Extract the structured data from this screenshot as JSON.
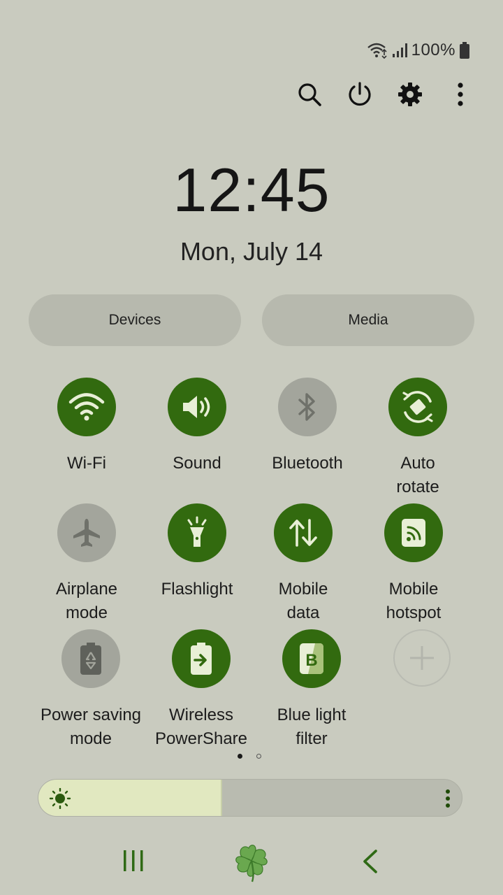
{
  "status": {
    "battery_pct": "100%",
    "icons": [
      "wifi-calling-icon",
      "signal-icon",
      "battery-icon"
    ]
  },
  "top_actions": [
    "search-icon",
    "power-icon",
    "gear-icon",
    "more-vert-icon"
  ],
  "clock": {
    "time": "12:45",
    "date": "Mon, July 14"
  },
  "pills": {
    "devices": "Devices",
    "media": "Media"
  },
  "tiles": [
    {
      "label": "Wi-Fi",
      "state": "on",
      "icon": "wifi-icon"
    },
    {
      "label": "Sound",
      "state": "on",
      "icon": "volume-icon"
    },
    {
      "label": "Bluetooth",
      "state": "off",
      "icon": "bluetooth-icon"
    },
    {
      "label": "Auto\nrotate",
      "state": "on",
      "icon": "auto-rotate-icon"
    },
    {
      "label": "Airplane\nmode",
      "state": "off",
      "icon": "airplane-icon"
    },
    {
      "label": "Flashlight",
      "state": "on",
      "icon": "flashlight-icon"
    },
    {
      "label": "Mobile\ndata",
      "state": "on",
      "icon": "mobile-data-icon"
    },
    {
      "label": "Mobile\nhotspot",
      "state": "on",
      "icon": "hotspot-icon"
    },
    {
      "label": "Power saving\nmode",
      "state": "off",
      "icon": "power-saving-icon"
    },
    {
      "label": "Wireless\nPowerShare",
      "state": "on",
      "icon": "wireless-powershare-icon"
    },
    {
      "label": "Blue light\nfilter",
      "state": "on",
      "icon": "blue-light-filter-icon"
    },
    {
      "label": "",
      "state": "add",
      "icon": "add-icon"
    }
  ],
  "pager": {
    "pages": 2,
    "current": 1
  },
  "brightness": {
    "level": 0.43
  },
  "colors": {
    "accent": "#326a0f",
    "background": "#c9cbbf",
    "tile_off": "#a3a59c",
    "brightness_fill": "#e1e8c0"
  },
  "navbar": [
    "recent-apps-icon",
    "home-clover-icon",
    "back-icon"
  ]
}
